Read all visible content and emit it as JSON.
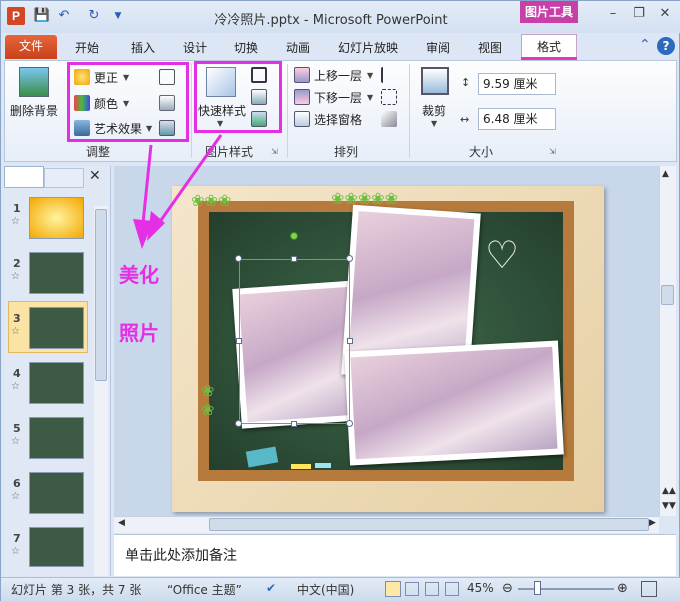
{
  "titlebar": {
    "app_logo": "P",
    "title": "冷冷照片.pptx - Microsoft PowerPoint",
    "context_tab_group": "图片工具",
    "qat_icons": [
      "save-icon",
      "undo-icon",
      "redo-icon",
      "customize-icon"
    ],
    "window_controls": [
      "minimize-icon",
      "restore-icon",
      "close-icon"
    ]
  },
  "tabs": {
    "file": "文件",
    "items": [
      "开始",
      "插入",
      "设计",
      "切换",
      "动画",
      "幻灯片放映",
      "审阅",
      "视图"
    ],
    "active": "格式"
  },
  "ribbon": {
    "remove_bg": "删除背景",
    "adjust": {
      "label": "调整",
      "corrections": "更正",
      "color": "颜色",
      "artistic_effects": "艺术效果"
    },
    "picture_styles": {
      "label": "图片样式",
      "quick_styles": "快速样式"
    },
    "arrange": {
      "label": "排列",
      "bring_forward": "上移一层",
      "send_backward": "下移一层",
      "selection_pane": "选择窗格"
    },
    "size": {
      "label": "大小",
      "crop": "裁剪",
      "height": "9.59 厘米",
      "width": "6.48 厘米"
    }
  },
  "slides_panel": {
    "thumbnails": [
      "1",
      "2",
      "3",
      "4",
      "5",
      "6",
      "7"
    ],
    "selected": "3"
  },
  "annotation": {
    "line1": "美化",
    "line2": "照片"
  },
  "notes": {
    "placeholder": "单击此处添加备注"
  },
  "status": {
    "slide_info": "幻灯片 第 3 张，共 7 张",
    "theme": "“Office 主题”",
    "language": "中文(中国)",
    "zoom": "45%"
  },
  "colors": {
    "accent_magenta": "#e52fe5",
    "file_tab": "#d24726",
    "context_header": "#c93fa8"
  }
}
